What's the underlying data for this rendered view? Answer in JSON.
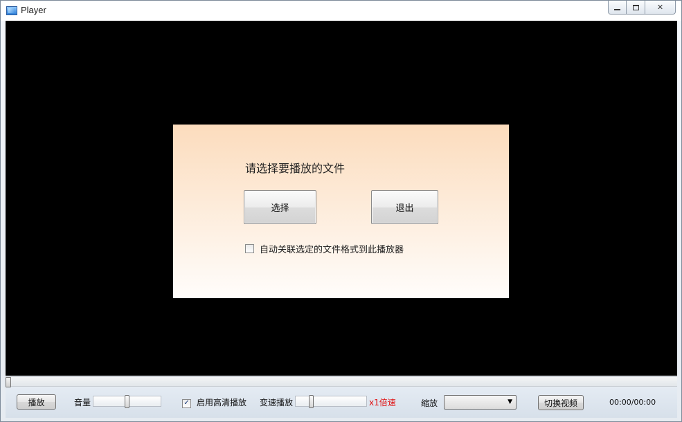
{
  "window": {
    "title": "Player"
  },
  "dialog": {
    "prompt": "请选择要播放的文件",
    "select_label": "选择",
    "exit_label": "退出",
    "associate_label": "自动关联选定的文件格式到此播放器",
    "associate_checked": false
  },
  "seek": {
    "progress": 0
  },
  "controls": {
    "play_label": "播放",
    "volume_label": "音量",
    "volume_level": 0.5,
    "hd_label": "启用高清播放",
    "hd_checked": true,
    "speed_label": "变速播放",
    "speed_level": 0.2,
    "speed_value": "x1倍速",
    "zoom_label": "缩放",
    "zoom_value": "",
    "switch_label": "切换视频",
    "time": "00:00/00:00"
  },
  "colors": {
    "speed_text": "#e01010",
    "video_bg": "#000000"
  }
}
